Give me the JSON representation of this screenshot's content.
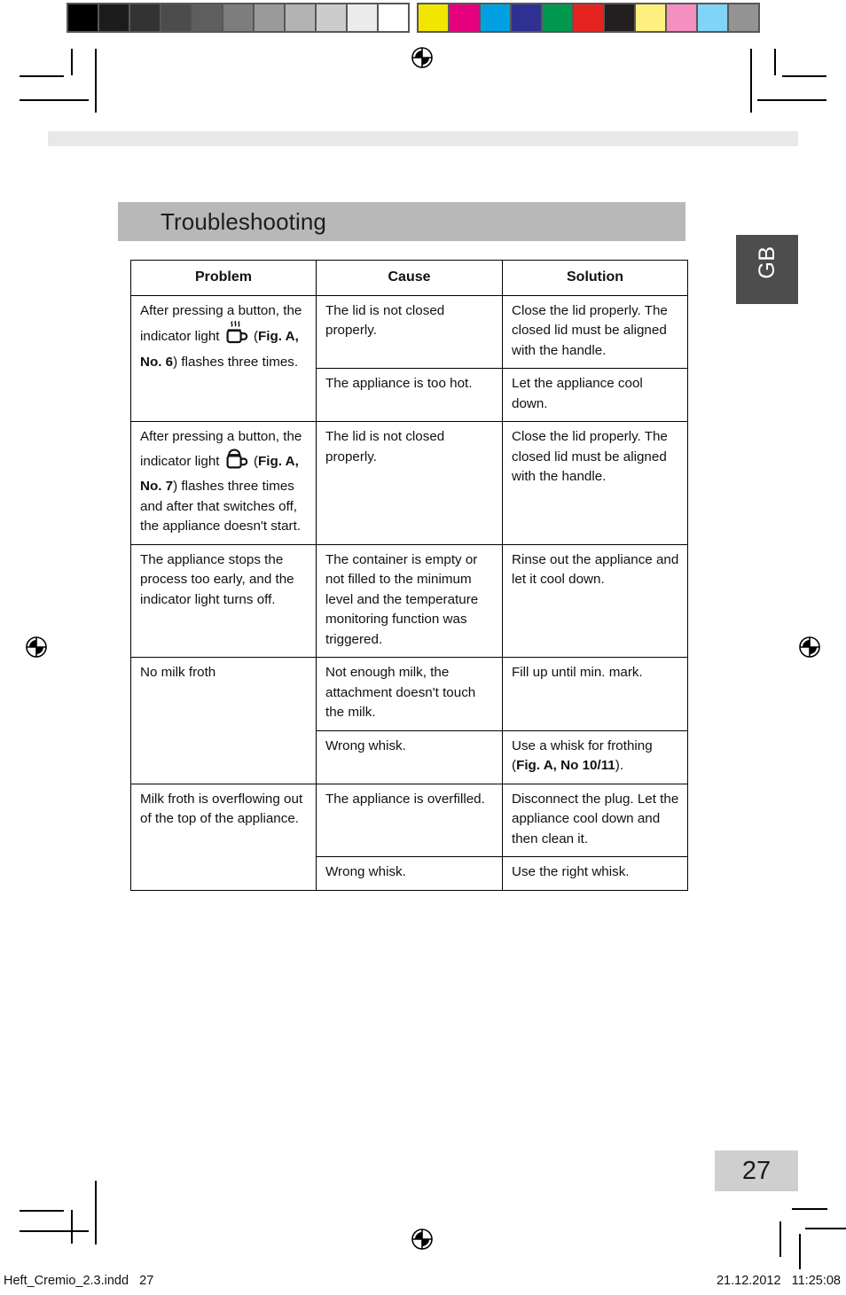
{
  "document": {
    "section_title": "Troubleshooting",
    "language_tab": "GB",
    "page_number": "27"
  },
  "footer": {
    "file_name": "Heft_Cremio_2.3.indd   27",
    "timestamp": "21.12.2012   11:25:08"
  },
  "table": {
    "headers": [
      "Problem",
      "Cause",
      "Solution"
    ],
    "groups": [
      {
        "problem_prefix": "After pressing a button, the indicator light ",
        "problem_icon": "hot-cup-with-steam-icon",
        "problem_ref_bold": "Fig. A, No. 6",
        "problem_suffix": ") flashes three times.",
        "rows": [
          {
            "cause": "The lid is not closed properly.",
            "solution": "Close the lid properly. The closed lid must be aligned with the handle."
          },
          {
            "cause": "The appliance is too hot.",
            "solution": "Let the appliance cool down."
          }
        ]
      },
      {
        "problem_prefix": "After pressing a button, the indicator light ",
        "problem_icon": "cold-cup-with-froth-icon",
        "problem_ref_bold": "Fig. A, No. 7",
        "problem_suffix": ") flashes three times and after that switches off, the appliance doesn't start.",
        "rows": [
          {
            "cause": "The lid is not closed properly.",
            "solution": "Close the lid properly. The closed lid must be aligned with the handle."
          }
        ]
      },
      {
        "problem_plain": "The appliance stops the process too early, and the indicator light turns off.",
        "rows": [
          {
            "cause": "The container is empty or not filled to the minimum level and the temperature monitoring function was triggered.",
            "solution": "Rinse out the appliance and let it cool down."
          }
        ]
      },
      {
        "problem_plain": "No milk froth",
        "rows": [
          {
            "cause": "Not enough milk, the attachment doesn't touch the milk.",
            "solution": "Fill up until min. mark."
          },
          {
            "cause": "Wrong whisk.",
            "solution_prefix": "Use a whisk for frothing (",
            "solution_bold": "Fig. A, No 10/11",
            "solution_suffix": ")."
          }
        ]
      },
      {
        "problem_plain": "Milk froth is overflowing out of the top of the appliance.",
        "rows": [
          {
            "cause": "The appliance is overfilled.",
            "solution": "Disconnect the plug. Let the appliance cool down and then clean it."
          },
          {
            "cause": "Wrong whisk.",
            "solution": "Use the right whisk."
          }
        ]
      }
    ]
  },
  "calibration": {
    "grayscale": [
      "#000000",
      "#1c1c1c",
      "#333333",
      "#4c4c4c",
      "#5e5e5e",
      "#7d7d7d",
      "#9a9a9a",
      "#b3b3b3",
      "#cccccc",
      "#ebebeb",
      "#ffffff"
    ],
    "colors": [
      "#f2e500",
      "#e5007d",
      "#00a0e3",
      "#2e3191",
      "#00994d",
      "#e52421",
      "#231f20",
      "#fdf07f",
      "#f490c0",
      "#80d4f5",
      "#939393"
    ]
  }
}
